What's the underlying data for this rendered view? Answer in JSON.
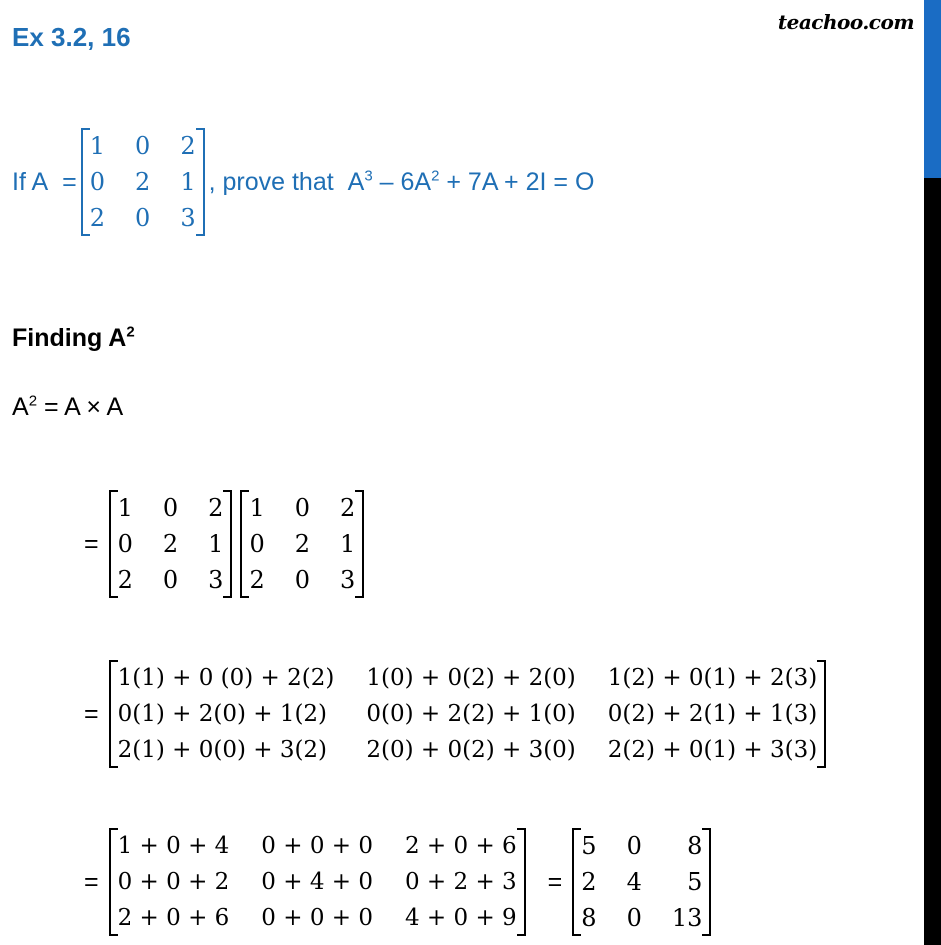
{
  "header": {
    "title": "Ex 3.2, 16",
    "brand": "teachoo.com"
  },
  "question": {
    "prefix": "If A",
    "equals": "=",
    "matrix_A": [
      [
        "1",
        "0",
        "2"
      ],
      [
        "0",
        "2",
        "1"
      ],
      [
        "2",
        "0",
        "3"
      ]
    ],
    "suffix": ", prove that",
    "statement": {
      "t1": "A",
      "t1_exp": "3",
      "t2": " – 6A",
      "t2_exp": "2",
      "t3": " + 7A + 2I = O"
    }
  },
  "solution": {
    "heading": "Finding A",
    "heading_exp": "2",
    "line1": {
      "lhs": "A",
      "lhs_exp": "2",
      "rhs": " = A × A"
    },
    "equals": "=",
    "step1": {
      "left": [
        [
          "1",
          "0",
          "2"
        ],
        [
          "0",
          "2",
          "1"
        ],
        [
          "2",
          "0",
          "3"
        ]
      ],
      "right": [
        [
          "1",
          "0",
          "2"
        ],
        [
          "0",
          "2",
          "1"
        ],
        [
          "2",
          "0",
          "3"
        ]
      ]
    },
    "step2": [
      [
        "1(1) + 0 (0) + 2(2)",
        "1(0) + 0(2) + 2(0)",
        "1(2) + 0(1) + 2(3)"
      ],
      [
        "0(1) + 2(0) + 1(2)",
        "0(0) + 2(2) + 1(0)",
        "0(2) + 2(1) + 1(3)"
      ],
      [
        "2(1) + 0(0) + 3(2)",
        "2(0) + 0(2) + 3(0)",
        "2(2) + 0(1) + 3(3)"
      ]
    ],
    "step3": [
      [
        "1 + 0 + 4",
        "0 + 0 + 0",
        "2 + 0 + 6"
      ],
      [
        "0 + 0 + 2",
        "0 + 4 + 0",
        "0 + 2 + 3"
      ],
      [
        "2 + 0 + 6",
        "0 + 0 + 0",
        "4 + 0 + 9"
      ]
    ],
    "result": [
      [
        "5",
        "0",
        "8"
      ],
      [
        "2",
        "4",
        "5"
      ],
      [
        "8",
        "0",
        "13"
      ]
    ]
  },
  "colors": {
    "accent": "#1f6fb5",
    "scroll_thumb": "#1a6cc4",
    "scroll_track": "#000000"
  }
}
